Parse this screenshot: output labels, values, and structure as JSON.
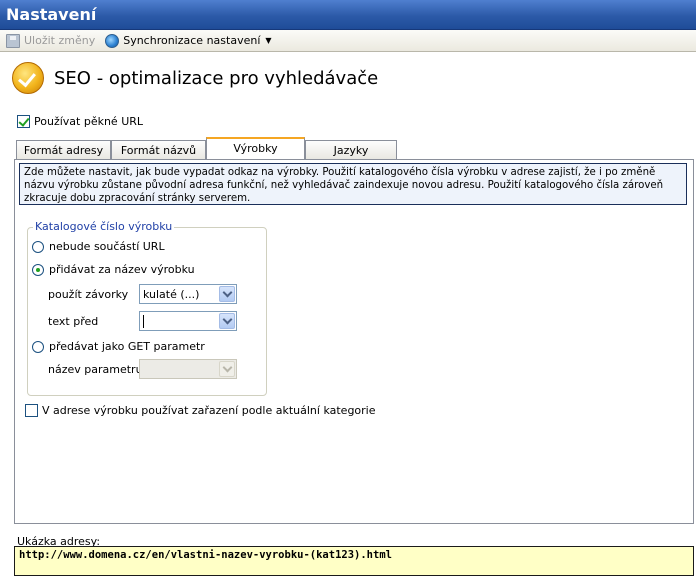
{
  "window": {
    "title": "Nastavení"
  },
  "toolbar": {
    "save_label": "Uložit změny",
    "sync_label": "Synchronizace nastavení"
  },
  "header": {
    "title": "SEO - optimalizace pro vyhledávače"
  },
  "pretty_url": {
    "label": "Používat pěkné URL",
    "checked": true
  },
  "tabs": [
    {
      "label": "Formát adresy"
    },
    {
      "label": "Formát názvů"
    },
    {
      "label": "Výrobky",
      "active": true
    },
    {
      "label": "Jazyky"
    }
  ],
  "info_text": "Zde můžete nastavit, jak bude vypadat odkaz na výrobky. Použití katalogového čísla výrobku v adrese zajistí, že i po změně názvu výrobku zůstane původní adresa funkční, než vyhledávač zaindexuje novou adresu. Použití katalogového čísla zároveň zkracuje dobu zpracování stránky serverem.",
  "catalog_group": {
    "legend": "Katalogové číslo výrobku",
    "option_none": "nebude součástí URL",
    "option_append": "přidávat za název výrobku",
    "brackets_label": "použít závorky",
    "brackets_value": "kulaté (...)",
    "prefix_label": "text před",
    "prefix_value": "",
    "option_get": "předávat jako GET parametr",
    "param_label": "název parametru",
    "param_value": ""
  },
  "category_option": {
    "label": "V adrese výrobku používat zařazení podle aktuální kategorie",
    "checked": false
  },
  "address_preview": {
    "label": "Ukázka adresy:",
    "value": "http://www.domena.cz/en/vlastni-nazev-vyrobku-(kat123).html"
  }
}
